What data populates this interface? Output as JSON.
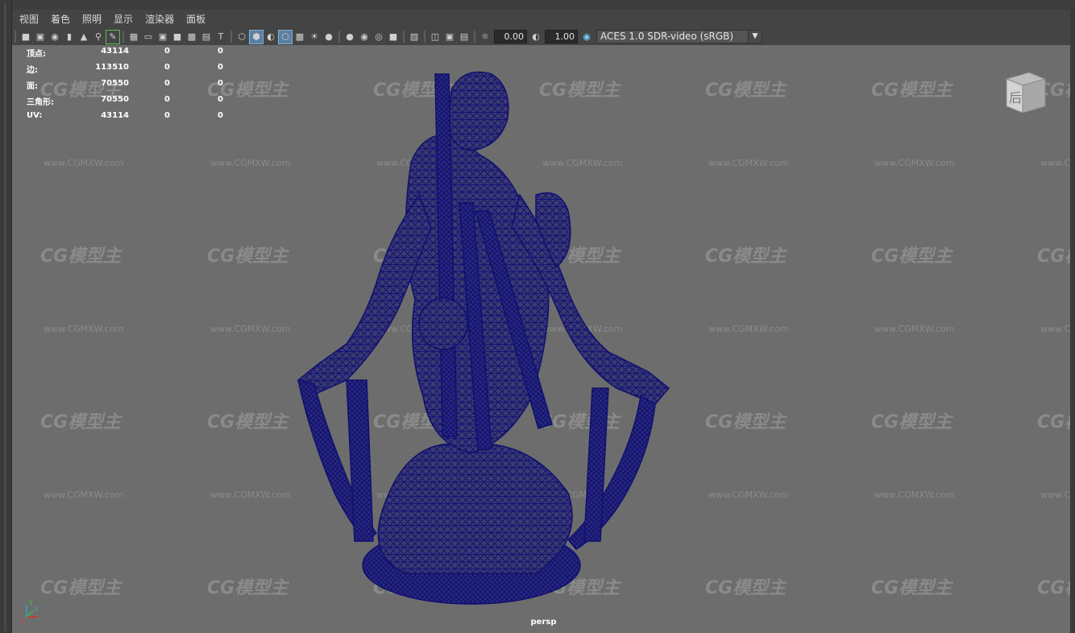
{
  "menu": [
    "视图",
    "着色",
    "照明",
    "显示",
    "渲染器",
    "面板"
  ],
  "toolbar": {
    "exposure": "0.00",
    "gamma": "1.00",
    "color_space": "ACES 1.0 SDR-video (sRGB)"
  },
  "hud": [
    {
      "label": "顶点:",
      "v1": "43114",
      "v2": "0",
      "v3": "0"
    },
    {
      "label": "边:",
      "v1": "113510",
      "v2": "0",
      "v3": "0"
    },
    {
      "label": "面:",
      "v1": "70550",
      "v2": "0",
      "v3": "0"
    },
    {
      "label": "三角形:",
      "v1": "70550",
      "v2": "0",
      "v3": "0"
    },
    {
      "label": "UV:",
      "v1": "43114",
      "v2": "0",
      "v3": "0"
    }
  ],
  "viewcube_label": "后",
  "camera_label": "persp",
  "watermark": {
    "logo": "CG模型主",
    "url": "www.CGMXW.com"
  },
  "colors": {
    "viewport_bg": "#6d6d6d",
    "wireframe": "#1a1a7a",
    "ui_bg": "#444444"
  },
  "icons": [
    "camera-icon",
    "lock-icon",
    "bookmark-icon",
    "grid-icon",
    "wireframe-icon",
    "shaded-icon",
    "lighting-icon",
    "shadow-icon",
    "isolate-icon",
    "xray-icon",
    "exposure-icon",
    "gamma-icon",
    "colorspace-icon"
  ]
}
